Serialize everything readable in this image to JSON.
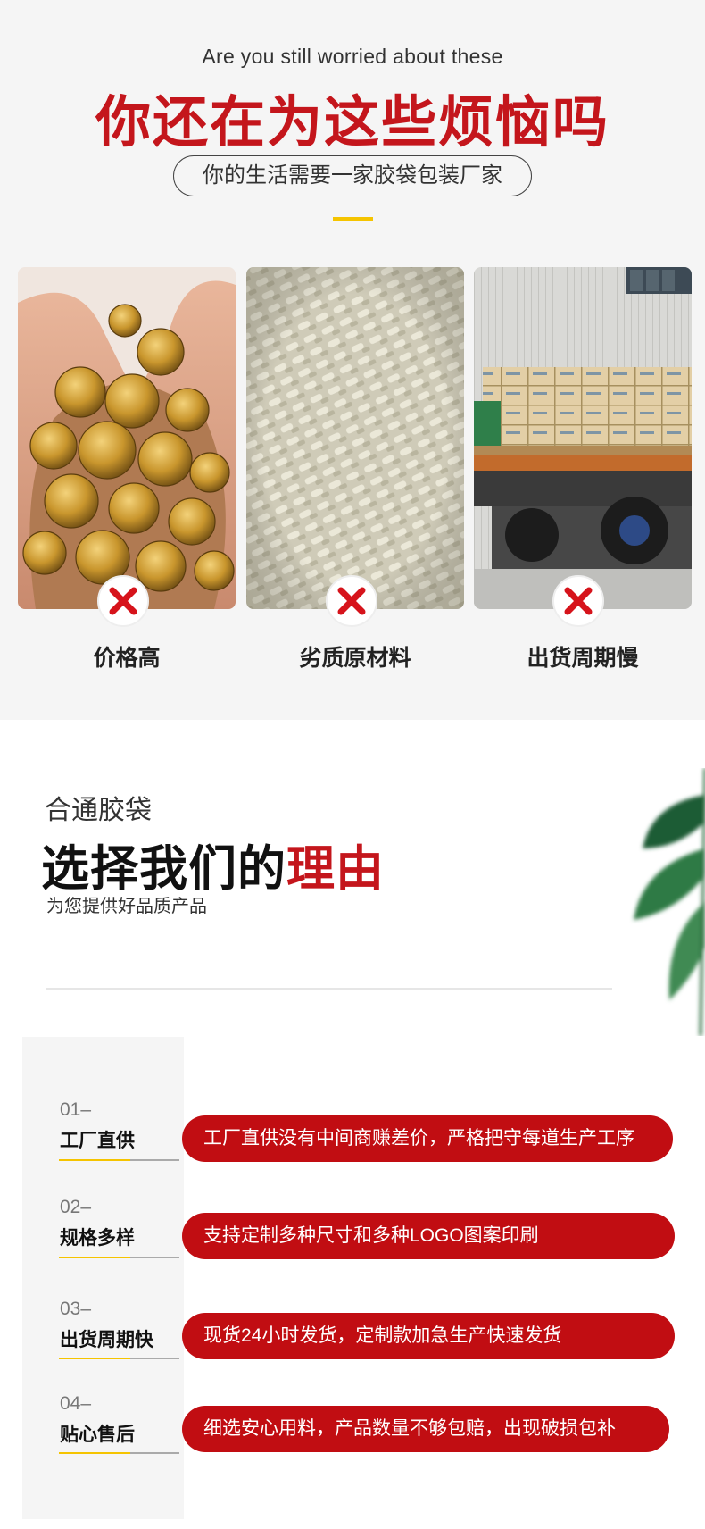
{
  "problems": {
    "subtitle_en": "Are you still worried about these",
    "title": "你还在为这些烦恼吗",
    "tagline": "你的生活需要一家胶袋包装厂家",
    "cards": [
      {
        "label": "价格高",
        "photo": "coins-in-hands"
      },
      {
        "label": "劣质原材料",
        "photo": "plastic-pellets"
      },
      {
        "label": "出货周期慢",
        "photo": "loaded-truck"
      }
    ],
    "icon": "x-mark-icon",
    "accent_color": "#c4161c",
    "highlight_color": "#f5c400"
  },
  "reasons": {
    "brand": "合通胶袋",
    "title_main": "选择我们的",
    "title_accent": "理由",
    "subtitle": "为您提供好品质产品",
    "items": [
      {
        "num": "01–",
        "label": "工厂直供",
        "desc": "工厂直供没有中间商赚差价，严格把守每道生产工序"
      },
      {
        "num": "02–",
        "label": "规格多样",
        "desc": "支持定制多种尺寸和多种LOGO图案印刷"
      },
      {
        "num": "03–",
        "label": "出货周期快",
        "desc": "现货24小时发货，定制款加急生产快速发货"
      },
      {
        "num": "04–",
        "label": "贴心售后",
        "desc": "细选安心用料，产品数量不够包赔，出现破损包补"
      }
    ],
    "pill_color": "#c10d12"
  }
}
